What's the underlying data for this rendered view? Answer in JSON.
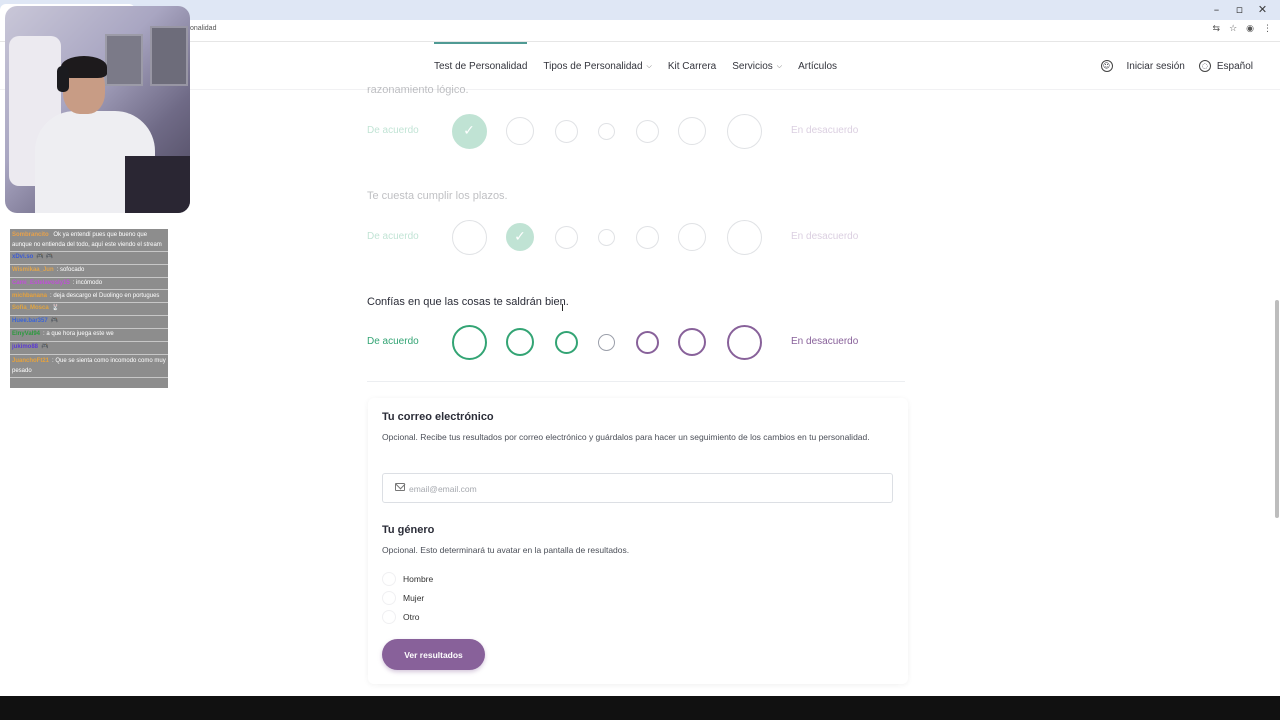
{
  "browser": {
    "url_fragment": "onalidad",
    "window_controls": [
      "–",
      "▫",
      "✕"
    ],
    "addr_icons": [
      "translate-icon",
      "star-icon",
      "profile-icon",
      "menu-icon"
    ]
  },
  "nav": {
    "links": [
      {
        "label": "Test de Personalidad",
        "active": true,
        "dropdown": false
      },
      {
        "label": "Tipos de Personalidad",
        "active": false,
        "dropdown": true
      },
      {
        "label": "Kit Carrera",
        "active": false,
        "dropdown": false
      },
      {
        "label": "Servicios",
        "active": false,
        "dropdown": true
      },
      {
        "label": "Artículos",
        "active": false,
        "dropdown": false
      }
    ],
    "login": "Iniciar sesión",
    "language": "Español"
  },
  "questions": [
    {
      "text": "razonamiento lógico.",
      "agree": "De acuerdo",
      "disagree": "En desacuerdo",
      "selected": 0,
      "answered": true
    },
    {
      "text": "Te cuesta cumplir los plazos.",
      "agree": "De acuerdo",
      "disagree": "En desacuerdo",
      "selected": 1,
      "answered": true
    },
    {
      "text": "Confías en que las cosas te saldrán bien.",
      "agree": "De acuerdo",
      "disagree": "En desacuerdo",
      "selected": null,
      "answered": false
    }
  ],
  "email_section": {
    "title": "Tu correo electrónico",
    "description": "Opcional. Recibe tus resultados por correo electrónico y guárdalos para hacer un seguimiento de los cambios en tu personalidad.",
    "placeholder": "email@email.com"
  },
  "gender_section": {
    "title": "Tu género",
    "description": "Opcional. Esto determinará tu avatar en la pantalla de resultados.",
    "options": [
      "Hombre",
      "Mujer",
      "Otro"
    ]
  },
  "submit_label": "Ver resultados",
  "chat_overlay": [
    {
      "user": "Sombrancito",
      "user_color": "#e8a14a",
      "msg": "  Ok ya entendí pues que bueno que aunque no entienda del todo, aquí este viendo el stream"
    },
    {
      "user": "xDvi.so",
      "user_color": "#3b5bd6",
      "msg": "🎮 🎮"
    },
    {
      "user": "Wismikaa_Jun",
      "user_color": "#e0a44c",
      "msg": ": sofocado"
    },
    {
      "user": "Cami_Estelavosly15",
      "user_color": "#c04fd8",
      "msg": ": incómodo"
    },
    {
      "user": "michbanana",
      "user_color": "#e6a23c",
      "msg": ": deja descargo el Duolingo en portugues"
    },
    {
      "user": "Sofia_Mosca",
      "user_color": "#e0a440",
      "msg": "🐰"
    },
    {
      "user": "Huee.bar357",
      "user_color": "#3a64d8",
      "msg": "🎮"
    },
    {
      "user": "ElnyVal94",
      "user_color": "#2b9a3e",
      "msg": ": a que hora juega este we"
    },
    {
      "user": "jukimo88",
      "user_color": "#5b3ad4",
      "msg": "🎮"
    },
    {
      "user": "JuanchoFt21",
      "user_color": "#e6a23c",
      "msg": ": Que se sienta como incomodo como muy pesado"
    }
  ],
  "colors": {
    "agree_green": "#33a474",
    "disagree_purple": "#88619a",
    "neutral_gray": "#9b9faa",
    "nav_accent": "#4f9a94"
  }
}
